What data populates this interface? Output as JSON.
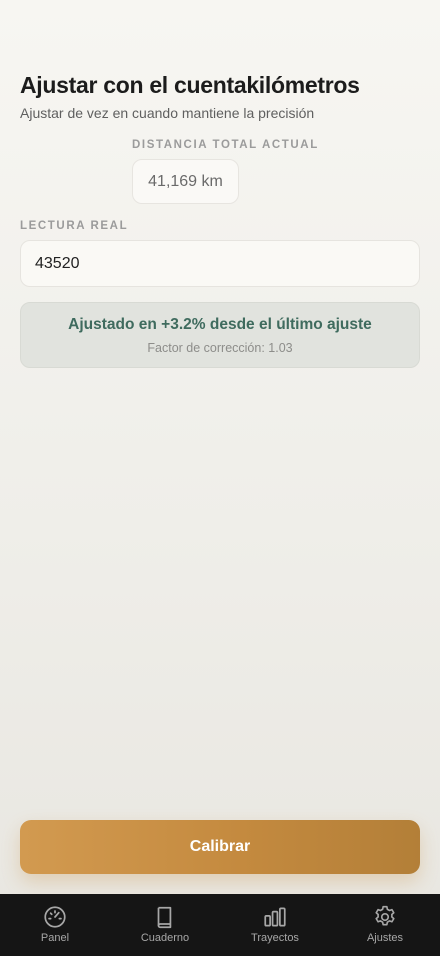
{
  "header": {
    "title": "Ajustar con el cuentakilómetros",
    "subtitle": "Ajustar de vez en cuando mantiene la precisión"
  },
  "current": {
    "label": "DISTANCIA TOTAL ACTUAL",
    "value": "41,169 km"
  },
  "reading": {
    "label": "LECTURA REAL",
    "value": "43520"
  },
  "result": {
    "main": "Ajustado en +3.2% desde el último ajuste",
    "sub": "Factor de corrección: 1.03"
  },
  "actions": {
    "calibrate_label": "Calibrar"
  },
  "tabs": [
    {
      "label": "Panel",
      "icon": "gauge-icon"
    },
    {
      "label": "Cuaderno",
      "icon": "book-icon"
    },
    {
      "label": "Trayectos",
      "icon": "bar-chart-icon"
    },
    {
      "label": "Ajustes",
      "icon": "gear-icon"
    }
  ],
  "colors": {
    "accent": "#c48a3f",
    "success_text": "#3f6b5e",
    "tabbar_bg": "#151515"
  }
}
